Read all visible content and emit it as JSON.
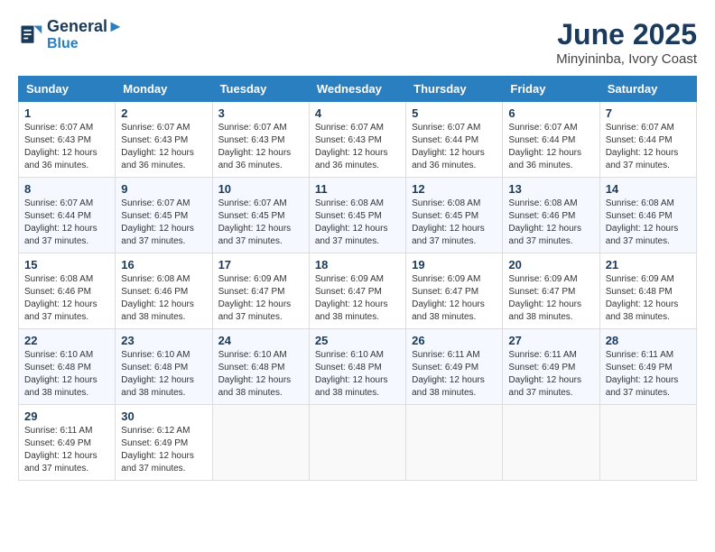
{
  "logo": {
    "line1": "General",
    "line2": "Blue"
  },
  "title": "June 2025",
  "location": "Minyininba, Ivory Coast",
  "days_of_week": [
    "Sunday",
    "Monday",
    "Tuesday",
    "Wednesday",
    "Thursday",
    "Friday",
    "Saturday"
  ],
  "weeks": [
    [
      {
        "day": "1",
        "sunrise": "6:07 AM",
        "sunset": "6:43 PM",
        "daylight": "12 hours and 36 minutes."
      },
      {
        "day": "2",
        "sunrise": "6:07 AM",
        "sunset": "6:43 PM",
        "daylight": "12 hours and 36 minutes."
      },
      {
        "day": "3",
        "sunrise": "6:07 AM",
        "sunset": "6:43 PM",
        "daylight": "12 hours and 36 minutes."
      },
      {
        "day": "4",
        "sunrise": "6:07 AM",
        "sunset": "6:43 PM",
        "daylight": "12 hours and 36 minutes."
      },
      {
        "day": "5",
        "sunrise": "6:07 AM",
        "sunset": "6:44 PM",
        "daylight": "12 hours and 36 minutes."
      },
      {
        "day": "6",
        "sunrise": "6:07 AM",
        "sunset": "6:44 PM",
        "daylight": "12 hours and 36 minutes."
      },
      {
        "day": "7",
        "sunrise": "6:07 AM",
        "sunset": "6:44 PM",
        "daylight": "12 hours and 37 minutes."
      }
    ],
    [
      {
        "day": "8",
        "sunrise": "6:07 AM",
        "sunset": "6:44 PM",
        "daylight": "12 hours and 37 minutes."
      },
      {
        "day": "9",
        "sunrise": "6:07 AM",
        "sunset": "6:45 PM",
        "daylight": "12 hours and 37 minutes."
      },
      {
        "day": "10",
        "sunrise": "6:07 AM",
        "sunset": "6:45 PM",
        "daylight": "12 hours and 37 minutes."
      },
      {
        "day": "11",
        "sunrise": "6:08 AM",
        "sunset": "6:45 PM",
        "daylight": "12 hours and 37 minutes."
      },
      {
        "day": "12",
        "sunrise": "6:08 AM",
        "sunset": "6:45 PM",
        "daylight": "12 hours and 37 minutes."
      },
      {
        "day": "13",
        "sunrise": "6:08 AM",
        "sunset": "6:46 PM",
        "daylight": "12 hours and 37 minutes."
      },
      {
        "day": "14",
        "sunrise": "6:08 AM",
        "sunset": "6:46 PM",
        "daylight": "12 hours and 37 minutes."
      }
    ],
    [
      {
        "day": "15",
        "sunrise": "6:08 AM",
        "sunset": "6:46 PM",
        "daylight": "12 hours and 37 minutes."
      },
      {
        "day": "16",
        "sunrise": "6:08 AM",
        "sunset": "6:46 PM",
        "daylight": "12 hours and 38 minutes."
      },
      {
        "day": "17",
        "sunrise": "6:09 AM",
        "sunset": "6:47 PM",
        "daylight": "12 hours and 37 minutes."
      },
      {
        "day": "18",
        "sunrise": "6:09 AM",
        "sunset": "6:47 PM",
        "daylight": "12 hours and 38 minutes."
      },
      {
        "day": "19",
        "sunrise": "6:09 AM",
        "sunset": "6:47 PM",
        "daylight": "12 hours and 38 minutes."
      },
      {
        "day": "20",
        "sunrise": "6:09 AM",
        "sunset": "6:47 PM",
        "daylight": "12 hours and 38 minutes."
      },
      {
        "day": "21",
        "sunrise": "6:09 AM",
        "sunset": "6:48 PM",
        "daylight": "12 hours and 38 minutes."
      }
    ],
    [
      {
        "day": "22",
        "sunrise": "6:10 AM",
        "sunset": "6:48 PM",
        "daylight": "12 hours and 38 minutes."
      },
      {
        "day": "23",
        "sunrise": "6:10 AM",
        "sunset": "6:48 PM",
        "daylight": "12 hours and 38 minutes."
      },
      {
        "day": "24",
        "sunrise": "6:10 AM",
        "sunset": "6:48 PM",
        "daylight": "12 hours and 38 minutes."
      },
      {
        "day": "25",
        "sunrise": "6:10 AM",
        "sunset": "6:48 PM",
        "daylight": "12 hours and 38 minutes."
      },
      {
        "day": "26",
        "sunrise": "6:11 AM",
        "sunset": "6:49 PM",
        "daylight": "12 hours and 38 minutes."
      },
      {
        "day": "27",
        "sunrise": "6:11 AM",
        "sunset": "6:49 PM",
        "daylight": "12 hours and 37 minutes."
      },
      {
        "day": "28",
        "sunrise": "6:11 AM",
        "sunset": "6:49 PM",
        "daylight": "12 hours and 37 minutes."
      }
    ],
    [
      {
        "day": "29",
        "sunrise": "6:11 AM",
        "sunset": "6:49 PM",
        "daylight": "12 hours and 37 minutes."
      },
      {
        "day": "30",
        "sunrise": "6:12 AM",
        "sunset": "6:49 PM",
        "daylight": "12 hours and 37 minutes."
      },
      null,
      null,
      null,
      null,
      null
    ]
  ]
}
